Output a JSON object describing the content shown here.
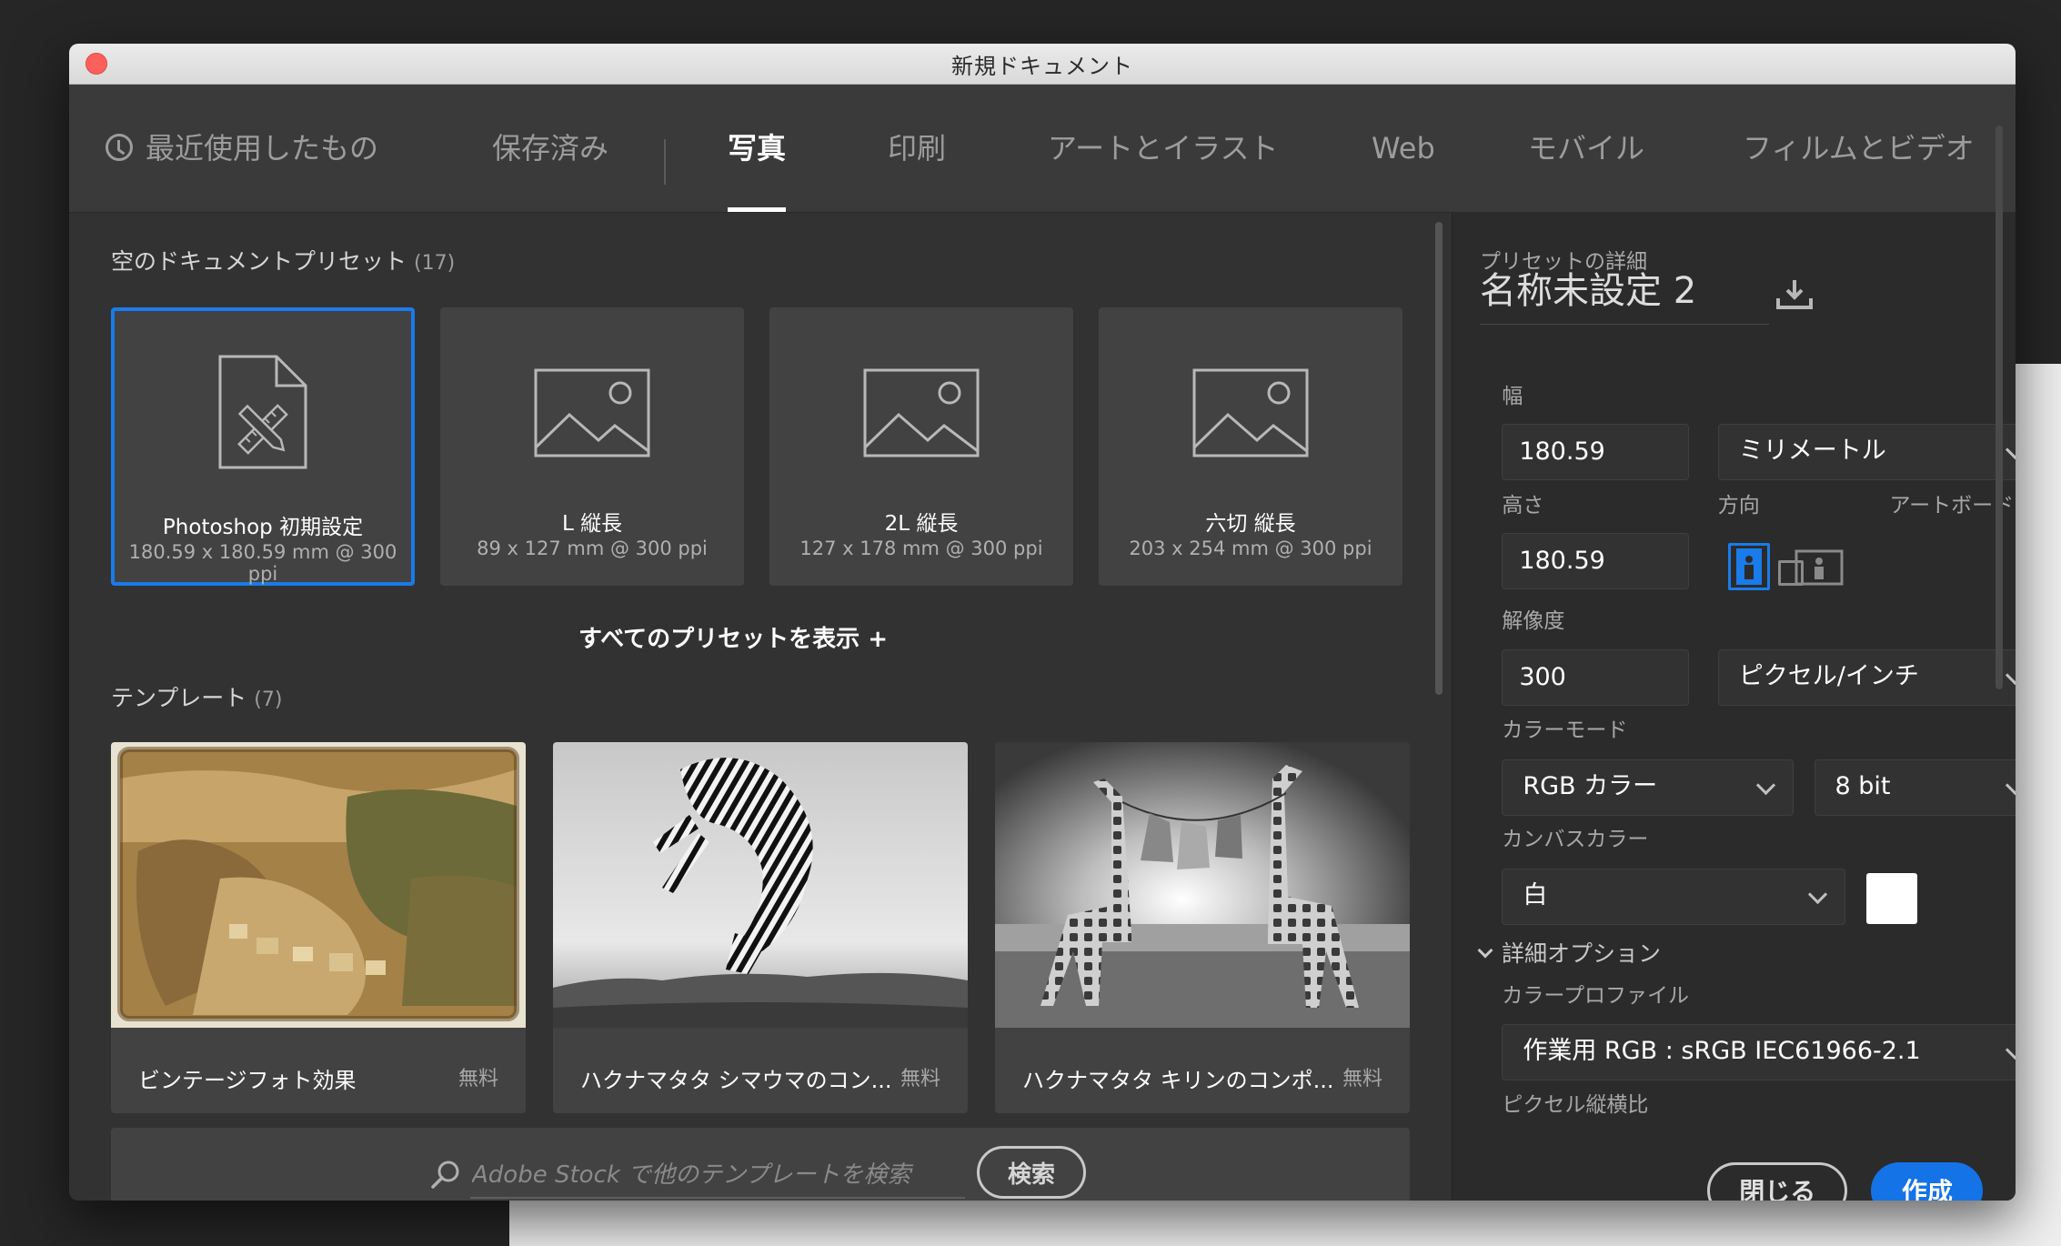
{
  "window": {
    "title": "新規ドキュメント"
  },
  "tabs": [
    {
      "label": "最近使用したもの",
      "icon": "clock-icon"
    },
    {
      "label": "保存済み"
    },
    {
      "label": "写真",
      "active": true
    },
    {
      "label": "印刷"
    },
    {
      "label": "アートとイラスト"
    },
    {
      "label": "Web"
    },
    {
      "label": "モバイル"
    },
    {
      "label": "フィルムとビデオ"
    }
  ],
  "presets_section": {
    "title": "空のドキュメントプリセット",
    "count": "(17)"
  },
  "presets": [
    {
      "name": "Photoshop 初期設定",
      "dims": "180.59 x 180.59 mm @ 300 ppi",
      "icon": "document-icon",
      "selected": true
    },
    {
      "name": "L 縦長",
      "dims": "89 x 127 mm @ 300 ppi",
      "icon": "image-icon"
    },
    {
      "name": "2L 縦長",
      "dims": "127 x 178 mm @ 300 ppi",
      "icon": "image-icon"
    },
    {
      "name": "六切 縦長",
      "dims": "203 x 254 mm @ 300 ppi",
      "icon": "image-icon"
    }
  ],
  "show_all_presets": "すべてのプリセットを表示 +",
  "templates_section": {
    "title": "テンプレート",
    "count": "(7)"
  },
  "templates": [
    {
      "name": "ビンテージフォト効果",
      "price": "無料"
    },
    {
      "name": "ハクナマタタ シマウマのコン...",
      "price": "無料"
    },
    {
      "name": "ハクナマタタ キリンのコンポ...",
      "price": "無料"
    }
  ],
  "stock_search": {
    "placeholder": "Adobe Stock で他のテンプレートを検索",
    "button": "検索"
  },
  "details": {
    "header": "プリセットの詳細",
    "preset_name": "名称未設定 2",
    "width_label": "幅",
    "width_value": "180.59",
    "unit": "ミリメートル",
    "height_label": "高さ",
    "height_value": "180.59",
    "orientation_label": "方向",
    "artboard_label": "アートボード",
    "resolution_label": "解像度",
    "resolution_value": "300",
    "resolution_unit": "ピクセル/インチ",
    "color_mode_label": "カラーモード",
    "color_mode": "RGB カラー",
    "bit_depth": "8 bit",
    "canvas_color_label": "カンバスカラー",
    "canvas_color": "白",
    "advanced_options": "詳細オプション",
    "color_profile_label": "カラープロファイル",
    "color_profile": "作業用 RGB : sRGB IEC61966-2.1",
    "pixel_aspect_label": "ピクセル縦横比"
  },
  "actions": {
    "close": "閉じる",
    "create": "作成"
  },
  "colors": {
    "accent": "#1473e6",
    "selection": "#1a7bea",
    "panel": "#323232"
  }
}
